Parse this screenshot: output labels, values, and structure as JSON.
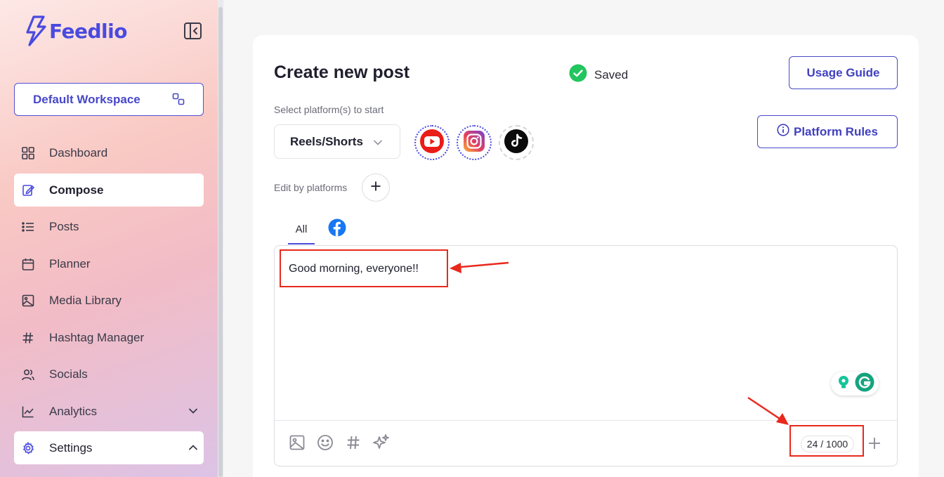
{
  "app": {
    "name": "Feedlio"
  },
  "sidebar": {
    "workspace": "Default Workspace",
    "items": [
      {
        "label": "Dashboard",
        "icon": "dashboard-icon"
      },
      {
        "label": "Compose",
        "icon": "compose-icon",
        "active": true
      },
      {
        "label": "Posts",
        "icon": "list-icon"
      },
      {
        "label": "Planner",
        "icon": "calendar-icon"
      },
      {
        "label": "Media Library",
        "icon": "image-icon"
      },
      {
        "label": "Hashtag Manager",
        "icon": "hashtag-icon"
      },
      {
        "label": "Socials",
        "icon": "users-icon"
      },
      {
        "label": "Analytics",
        "icon": "chart-icon",
        "chevron": "down"
      },
      {
        "label": "Settings",
        "icon": "gear-icon",
        "chevron": "up"
      }
    ]
  },
  "main": {
    "title": "Create new post",
    "saved_label": "Saved",
    "usage_guide": "Usage Guide",
    "platform_rules": "Platform Rules",
    "select_hint": "Select platform(s) to start",
    "post_type": "Reels/Shorts",
    "platforms": [
      {
        "name": "youtube-icon",
        "selected": true
      },
      {
        "name": "instagram-icon",
        "selected": true
      },
      {
        "name": "tiktok-icon",
        "selected": false
      }
    ],
    "edit_by_platforms": "Edit by platforms",
    "tabs": [
      {
        "label": "All",
        "active": true
      },
      {
        "label": "",
        "icon": "facebook-icon"
      }
    ],
    "editor_text": "Good morning, everyone!!",
    "counter": "24 / 1000"
  },
  "colors": {
    "accent": "#4a4ae0",
    "annotation": "#e8291c",
    "saved": "#22c55e"
  }
}
